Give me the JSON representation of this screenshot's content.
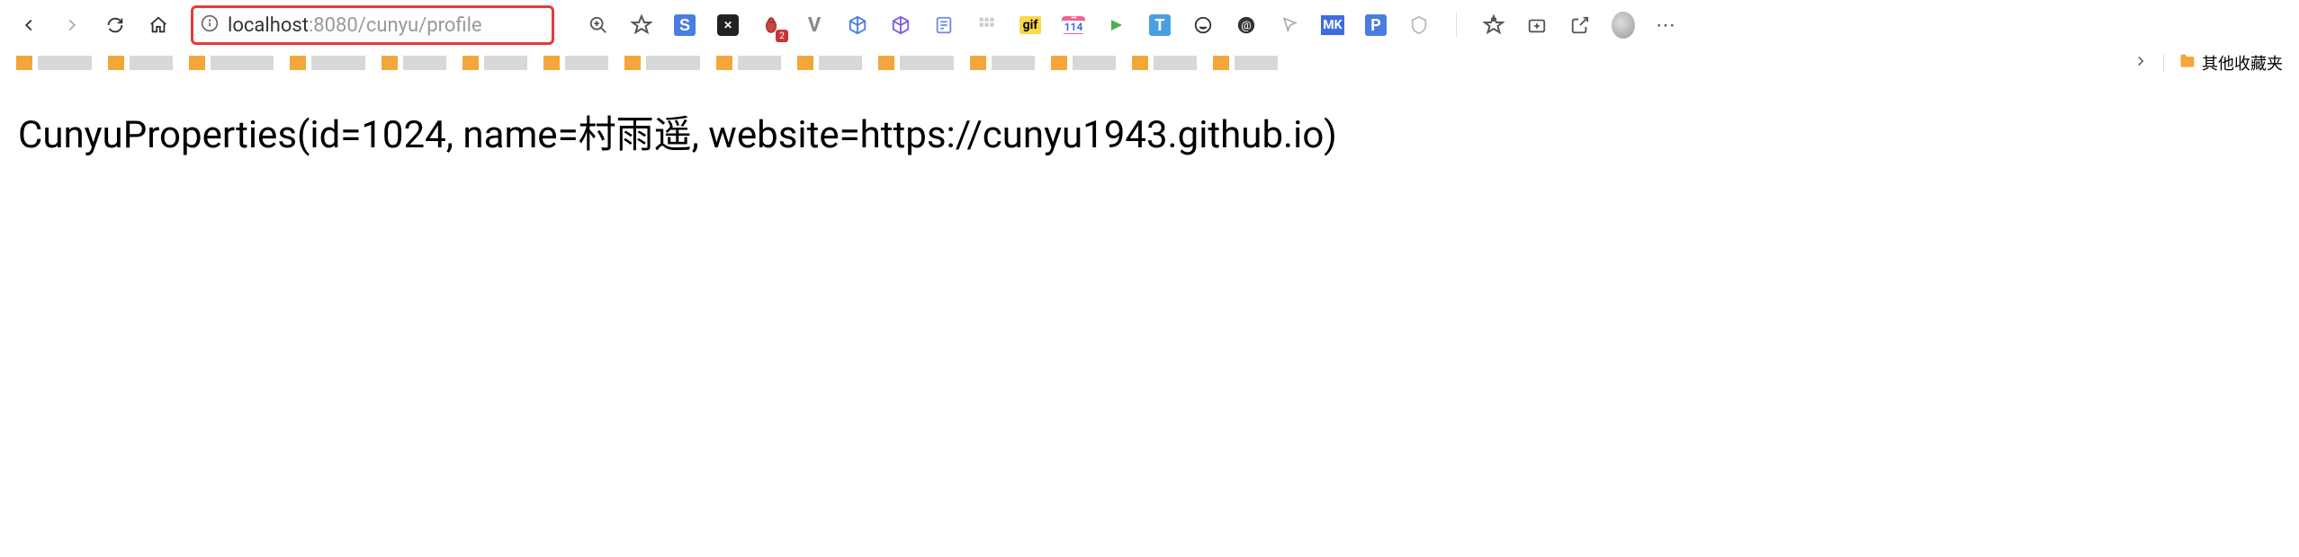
{
  "nav": {
    "back": "←",
    "forward": "→",
    "refresh": "↻",
    "home": "⌂"
  },
  "address": {
    "host": "localhost",
    "port": ":8080",
    "path": "/cunyu/profile"
  },
  "toolbar_icons": {
    "zoom": "⊕",
    "favorite": "☆",
    "collections_star": "⭐",
    "add_tab": "⊞",
    "share": "↗",
    "more": "⋯"
  },
  "extensions": {
    "ext1_label": "S",
    "ext2_label": "✕",
    "ext3_badge": "2",
    "ext5_label": "V",
    "gif_label": "gif",
    "cal_num": "114",
    "t_label": "T",
    "mk_label": "MK",
    "p_label": "P"
  },
  "bookmark_bar": {
    "other_folder": "其他收藏夹"
  },
  "content": {
    "text": "CunyuProperties(id=1024, name=村雨遥, website=https://cunyu1943.github.io)"
  }
}
